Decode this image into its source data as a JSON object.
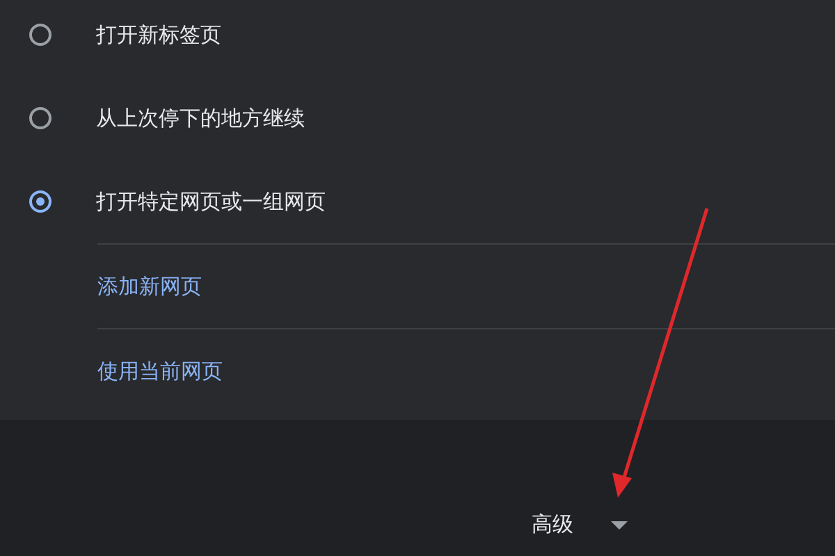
{
  "startup_options": [
    {
      "label": "打开新标签页",
      "selected": false
    },
    {
      "label": "从上次停下的地方继续",
      "selected": false
    },
    {
      "label": "打开特定网页或一组网页",
      "selected": true
    }
  ],
  "page_actions": [
    "添加新网页",
    "使用当前网页"
  ],
  "advanced": {
    "label": "高级",
    "expanded": false
  }
}
